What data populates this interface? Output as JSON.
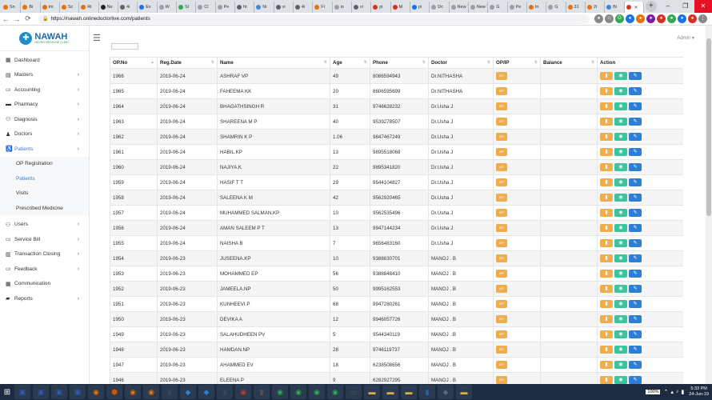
{
  "browser": {
    "tabs": [
      {
        "label": "Sn",
        "color": "#e8710a"
      },
      {
        "label": "Bi",
        "color": "#e8710a"
      },
      {
        "label": "Ini",
        "color": "#e8710a"
      },
      {
        "label": "Sc",
        "color": "#e8710a"
      },
      {
        "label": "Ri",
        "color": "#e8710a"
      },
      {
        "label": "Ne",
        "color": "#222222"
      },
      {
        "label": "4i",
        "color": "#5f6368"
      },
      {
        "label": "Ex",
        "color": "#1a73e8"
      },
      {
        "label": "W",
        "color": "#9aa0a6"
      },
      {
        "label": "Sl",
        "color": "#34a853"
      },
      {
        "label": "Cl",
        "color": "#9aa0a6"
      },
      {
        "label": "Pe",
        "color": "#9aa0a6"
      },
      {
        "label": "ht",
        "color": "#5f6368"
      },
      {
        "label": "Ni",
        "color": "#3c8ad8"
      },
      {
        "label": "vi",
        "color": "#5f6368"
      },
      {
        "label": "4i",
        "color": "#5f6368"
      },
      {
        "label": "Fi",
        "color": "#e8710a"
      },
      {
        "label": "lo",
        "color": "#9aa0a6"
      },
      {
        "label": "vi",
        "color": "#5f6368"
      },
      {
        "label": "pi",
        "color": "#d93025"
      },
      {
        "label": "M",
        "color": "#d93025"
      },
      {
        "label": "pi",
        "color": "#1a73e8"
      },
      {
        "label": "Dc",
        "color": "#9aa0a6"
      },
      {
        "label": "New Ti",
        "color": "#9aa0a6"
      },
      {
        "label": "New Ti",
        "color": "#9aa0a6"
      },
      {
        "label": "G",
        "color": "#9aa0a6"
      },
      {
        "label": "Pe",
        "color": "#9aa0a6"
      },
      {
        "label": "In",
        "color": "#e8710a"
      },
      {
        "label": "G",
        "color": "#9aa0a6"
      },
      {
        "label": "31",
        "color": "#e8710a"
      },
      {
        "label": "2i",
        "color": "#e8710a"
      },
      {
        "label": "Bi",
        "color": "#3c8ad8"
      },
      {
        "label": "",
        "color": "#d93025"
      }
    ],
    "active_tab_index": 32,
    "new_tab": "+",
    "win_controls": {
      "min": "–",
      "max": "❐",
      "close": "✕"
    },
    "url": "https://nawah.onlinedoctorlive.com/patients",
    "nav": {
      "back": "←",
      "forward": "→",
      "reload": "⟳"
    },
    "extensions": [
      {
        "glyph": "●",
        "color": "#888888"
      },
      {
        "glyph": "☆",
        "color": "#888888"
      },
      {
        "glyph": "G",
        "color": "#34a853"
      },
      {
        "glyph": "●",
        "color": "#1a73e8"
      },
      {
        "glyph": "●",
        "color": "#e8710a"
      },
      {
        "glyph": "●",
        "color": "#7b1fa2"
      },
      {
        "glyph": "●",
        "color": "#d93025"
      },
      {
        "glyph": "●",
        "color": "#34a853"
      },
      {
        "glyph": "●",
        "color": "#1a73e8"
      },
      {
        "glyph": "●",
        "color": "#d93025"
      },
      {
        "glyph": "⋮",
        "color": "#888888"
      }
    ]
  },
  "logo": {
    "name": "NAWAH",
    "tagline": "NEURO MEDICINE CLINIC"
  },
  "sidebar": {
    "items": [
      {
        "label": "Dashboard",
        "icon": "▦",
        "chev": ""
      },
      {
        "label": "Masters",
        "icon": "▤",
        "chev": "›"
      },
      {
        "label": "Accounting",
        "icon": "▭",
        "chev": "›"
      },
      {
        "label": "Pharmacy",
        "icon": "▬",
        "chev": "›"
      },
      {
        "label": "Diagnosis",
        "icon": "⚇",
        "chev": "›"
      },
      {
        "label": "Doctors",
        "icon": "♟",
        "chev": "›"
      },
      {
        "label": "Patients",
        "icon": "♿",
        "chev": "›"
      }
    ],
    "patients_sub": [
      "OP Registration",
      "Patients",
      "Visits",
      "Prescribed Medicine"
    ],
    "items2": [
      {
        "label": "Users",
        "icon": "⚇",
        "chev": "›"
      },
      {
        "label": "Service Bill",
        "icon": "▭",
        "chev": "›"
      },
      {
        "label": "Transaction Closing",
        "icon": "▥",
        "chev": "›"
      },
      {
        "label": "Feedback",
        "icon": "▭",
        "chev": "›"
      },
      {
        "label": "Communication",
        "icon": "▦",
        "chev": ""
      },
      {
        "label": "Reports",
        "icon": "▰",
        "chev": "›"
      }
    ]
  },
  "topbar": {
    "menu_glyph": "☰",
    "user": "Admin ▾"
  },
  "table": {
    "headers": [
      "OP.No",
      "Reg.Date",
      "Name",
      "Age",
      "Phone",
      "Doctor",
      "OP/IP",
      "Balance",
      "Action"
    ],
    "op_label": "OP",
    "actions": [
      "▮",
      "◉",
      "✎"
    ],
    "rows": [
      [
        "1966",
        "2019-06-24",
        "ASHRAF VP",
        "49",
        "8086594943",
        "Dr.NITHASHA"
      ],
      [
        "1965",
        "2019-06-24",
        "FAHEEMA KK",
        "20",
        "8606595699",
        "Dr.NITHASHA"
      ],
      [
        "1964",
        "2019-06-24",
        "BHAGATHSINGH R",
        "31",
        "9746628232",
        "Dr.Usha J"
      ],
      [
        "1963",
        "2019-06-24",
        "SHAREENA M P",
        "40",
        "9539278507",
        "Dr.Usha J"
      ],
      [
        "1962",
        "2019-06-24",
        "SHAMRIN K P",
        "1.06",
        "9847467249",
        "Dr.Usha J"
      ],
      [
        "1961",
        "2019-06-24",
        "HABIL.KP",
        "13",
        "9895518068",
        "Dr.Usha J"
      ],
      [
        "1960",
        "2019-06-24",
        "NAJIYA.K",
        "22",
        "9895341820",
        "Dr.Usha J"
      ],
      [
        "1959",
        "2019-06-24",
        "HASIF T T",
        "29",
        "9544104827",
        "Dr.Usha J"
      ],
      [
        "1958",
        "2019-06-24",
        "SALEENA K M",
        "42",
        "9562920465",
        "Dr.Usha J"
      ],
      [
        "1957",
        "2019-06-24",
        "MUHAMMED SALMAN.KP",
        "10",
        "9562535496",
        "Dr.Usha J"
      ],
      [
        "1956",
        "2019-06-24",
        "AMAN SALEEM P T",
        "13",
        "9947144234",
        "Dr.Usha J"
      ],
      [
        "1955",
        "2019-06-24",
        "NAISHA B",
        "7",
        "9656483160",
        "Dr.Usha J"
      ],
      [
        "1954",
        "2019-06-23",
        "JUSEENA.KP",
        "10",
        "9388830701",
        "MANOJ . B"
      ],
      [
        "1953",
        "2019-06-23",
        "MOHAMMED EP",
        "56",
        "9388848410",
        "MANOJ . B"
      ],
      [
        "1952",
        "2019-06-23",
        "JAMEELA.NP",
        "50",
        "9995162553",
        "MANOJ . B"
      ],
      [
        "1951",
        "2019-06-23",
        "KUNHEEVI.P",
        "68",
        "9947280261",
        "MANOJ . B"
      ],
      [
        "1950",
        "2019-06-23",
        "DEVIKA A",
        "12",
        "9946057726",
        "MANOJ . B"
      ],
      [
        "1949",
        "2019-06-23",
        "SALAHUDHEEN PV",
        "5",
        "9544340119",
        "MANOJ . B"
      ],
      [
        "1948",
        "2019-06-23",
        "HAMDAN.NP",
        "28",
        "9746119737",
        "MANOJ . B"
      ],
      [
        "1947",
        "2019-06-23",
        "AHAMMED EV",
        "18",
        "6238508656",
        "MANOJ . B"
      ],
      [
        "1946",
        "2019-06-23",
        "ELEENA P",
        "9",
        "6282927295",
        "MANOJ . B"
      ]
    ]
  },
  "taskbar": {
    "start_glyph": "⊞",
    "apps": [
      {
        "glyph": "▣",
        "color": "#2a5db0"
      },
      {
        "glyph": "▣",
        "color": "#2a5db0"
      },
      {
        "glyph": "▣",
        "color": "#2a5db0"
      },
      {
        "glyph": "▣",
        "color": "#2a5db0"
      },
      {
        "glyph": "◉",
        "color": "#e8710a"
      },
      {
        "glyph": "⬢",
        "color": "#d35400"
      },
      {
        "glyph": "◉",
        "color": "#e8710a"
      },
      {
        "glyph": "◉",
        "color": "#e8710a"
      },
      {
        "glyph": "▮",
        "color": "#34495e"
      },
      {
        "glyph": "◆",
        "color": "#2b7fd4"
      },
      {
        "glyph": "◆",
        "color": "#2b7fd4"
      },
      {
        "glyph": "▮",
        "color": "#34495e"
      },
      {
        "glyph": "◉",
        "color": "#c0392b"
      },
      {
        "glyph": "▮",
        "color": "#555555"
      },
      {
        "glyph": "◉",
        "color": "#34a853"
      },
      {
        "glyph": "◉",
        "color": "#34a853"
      },
      {
        "glyph": "◉",
        "color": "#34a853"
      },
      {
        "glyph": "◉",
        "color": "#34a853"
      },
      {
        "glyph": "▭",
        "color": "#555555"
      },
      {
        "glyph": "▬",
        "color": "#e0b040"
      },
      {
        "glyph": "▬",
        "color": "#e0b040"
      },
      {
        "glyph": "▬",
        "color": "#e0b040"
      },
      {
        "glyph": "▮",
        "color": "#2a5db0"
      },
      {
        "glyph": "◆",
        "color": "#5a6a7a"
      },
      {
        "glyph": "▬",
        "color": "#e0b040"
      }
    ],
    "battery": "100%",
    "tray_icons": [
      "⌃",
      "▴",
      "♪",
      "▮"
    ],
    "time": "5:33 PM",
    "date": "24-Jun-19"
  }
}
